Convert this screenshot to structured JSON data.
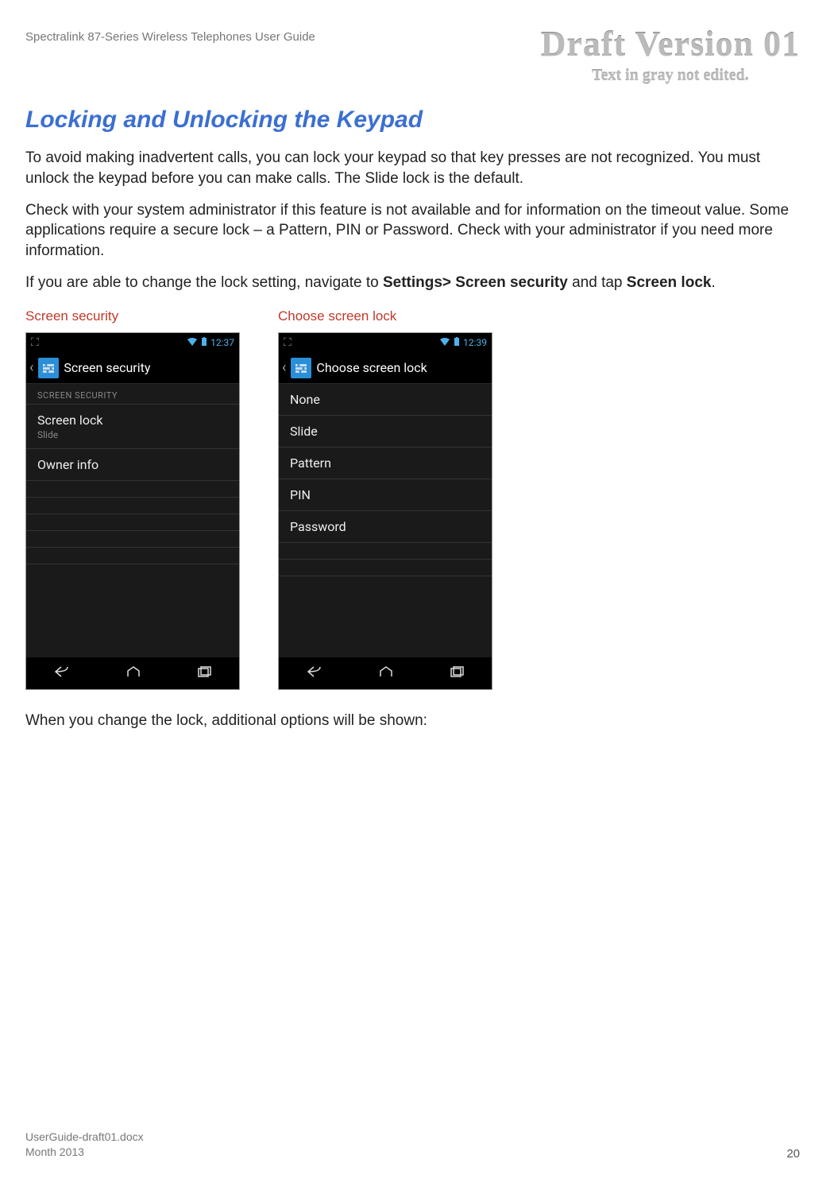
{
  "header": {
    "doc_title": "Spectralink 87-Series Wireless Telephones User Guide",
    "watermark_title": "Draft Version 01",
    "watermark_sub": "Text in gray not edited."
  },
  "section": {
    "heading": "Locking and Unlocking the Keypad",
    "p1": "To avoid making inadvertent calls, you can lock your keypad so that key presses are not recognized. You must unlock the keypad before you can make calls. The Slide lock is the default.",
    "p2": "Check with your system administrator if this feature is not available and for information on the timeout value. Some applications require a secure lock – a Pattern, PIN or Password. Check with your administrator if you need more information.",
    "p3_a": "If you are able to change the lock setting, navigate to ",
    "p3_b": "Settings> Screen security",
    "p3_c": " and tap ",
    "p3_d": "Screen lock",
    "p3_e": ".",
    "p4": "When you change the lock, additional options will be shown:"
  },
  "captions": {
    "left": "Screen security",
    "right": "Choose screen lock"
  },
  "phone1": {
    "time": "12:37",
    "title": "Screen security",
    "section_header": "SCREEN SECURITY",
    "items": [
      {
        "title": "Screen lock",
        "sub": "Slide"
      },
      {
        "title": "Owner info",
        "sub": ""
      }
    ]
  },
  "phone2": {
    "time": "12:39",
    "title": "Choose screen lock",
    "items": [
      {
        "title": "None"
      },
      {
        "title": "Slide"
      },
      {
        "title": "Pattern"
      },
      {
        "title": "PIN"
      },
      {
        "title": "Password"
      }
    ]
  },
  "footer": {
    "filename": "UserGuide-draft01.docx",
    "date": "Month 2013",
    "page": "20"
  }
}
